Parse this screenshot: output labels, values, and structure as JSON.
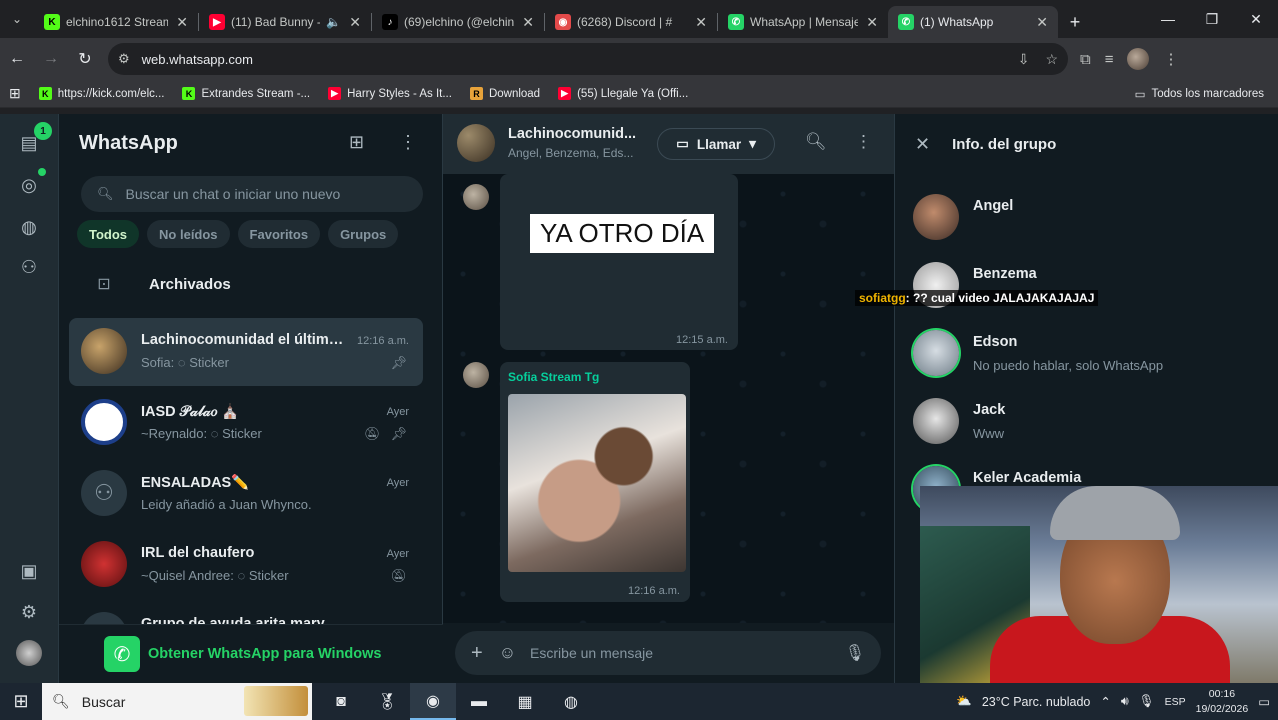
{
  "browser": {
    "tabs": [
      {
        "title": "elchino1612 Stream -",
        "favicon": "kick-icon",
        "color": "#53fc18",
        "active": false
      },
      {
        "title": "(11) Bad Bunny -",
        "favicon": "youtube-icon",
        "color": "#ff0033",
        "active": false
      },
      {
        "title": "(69)elchino (@elchino",
        "favicon": "tiktok-icon",
        "color": "#ffffff",
        "active": false
      },
      {
        "title": "(6268) Discord | #",
        "favicon": "discord-icon",
        "color": "#e34a4a",
        "active": false
      },
      {
        "title": "WhatsApp | Mensaje",
        "favicon": "whatsapp-icon",
        "color": "#25d366",
        "active": false
      },
      {
        "title": "(1) WhatsApp",
        "favicon": "whatsapp-icon",
        "color": "#25d366",
        "active": true
      }
    ],
    "url": "web.whatsapp.com",
    "bookmarks": [
      {
        "label": "https://kick.com/elc...",
        "favicon": "kick-icon",
        "color": "#53fc18"
      },
      {
        "label": "Extrandes Stream -...",
        "favicon": "kick-icon",
        "color": "#53fc18"
      },
      {
        "label": "Harry Styles - As It...",
        "favicon": "youtube-icon",
        "color": "#ff0033"
      },
      {
        "label": "Download",
        "favicon": "download-icon",
        "color": "#e8a33a"
      },
      {
        "label": "(55) Llegale Ya (Offi...",
        "favicon": "youtube-icon",
        "color": "#ff0033"
      }
    ],
    "all_bookmarks_label": "Todos los marcadores"
  },
  "rail": {
    "chats_badge": "1"
  },
  "chatlist": {
    "title": "WhatsApp",
    "search_placeholder": "Buscar un chat o iniciar uno nuevo",
    "filters": [
      "Todos",
      "No leídos",
      "Favoritos",
      "Grupos"
    ],
    "active_filter": "Todos",
    "archived_label": "Archivados",
    "chats": [
      {
        "name": "Lachinocomunidad el último ...",
        "time": "12:16 a.m.",
        "preview": "Sofia: ◌ Sticker",
        "pinned": true,
        "muted": false,
        "selected": true
      },
      {
        "name": "IASD 𝒫𝒶𝓁𝒶𝑜 ⛪",
        "time": "Ayer",
        "preview": "~Reynaldo: ◌ Sticker",
        "pinned": true,
        "muted": true,
        "selected": false
      },
      {
        "name": "ENSALADAS✏️",
        "time": "Ayer",
        "preview": "Leidy añadió a Juan Whynco.",
        "pinned": false,
        "muted": false,
        "selected": false
      },
      {
        "name": "IRL del chaufero",
        "time": "Ayer",
        "preview": "~Quisel Andree: ◌ Sticker",
        "pinned": false,
        "muted": true,
        "selected": false
      },
      {
        "name": "Grupo de ayuda arita mary",
        "time": "",
        "preview": "",
        "pinned": false,
        "muted": false,
        "selected": false
      }
    ],
    "get_windows_label": "Obtener WhatsApp para Windows"
  },
  "conversation": {
    "name": "Lachinocomunid...",
    "members": "Angel, Benzema, Eds...",
    "call_label": "Llamar",
    "messages": [
      {
        "type": "sticker",
        "text": "YA OTRO DÍA",
        "time": "12:15 a.m."
      },
      {
        "type": "photo",
        "sender": "Sofia Stream Tg",
        "time": "12:16 a.m."
      }
    ],
    "composer_placeholder": "Escribe un mensaje"
  },
  "group_info": {
    "title": "Info. del grupo",
    "members": [
      {
        "name": "Angel",
        "status": ""
      },
      {
        "name": "Benzema",
        "status": ""
      },
      {
        "name": "Edson",
        "status": "No puedo hablar, solo WhatsApp"
      },
      {
        "name": "Jack",
        "status": "Www"
      },
      {
        "name": "Keler Academia",
        "status": ""
      }
    ]
  },
  "stream_overlay": {
    "user": "sofiatgg",
    "message": ": ?? cual video JALAJAKAJAJAJ"
  },
  "taskbar": {
    "search_placeholder": "Buscar",
    "weather": "23°C  Parc. nublado",
    "language": "ESP",
    "time": "00:16",
    "date": "19/02/2026"
  }
}
